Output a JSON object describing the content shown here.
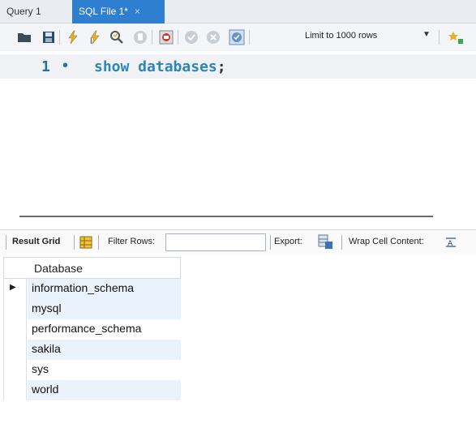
{
  "tabs": [
    {
      "label": "Query 1"
    },
    {
      "label": "SQL File 1*",
      "close": "×"
    }
  ],
  "toolbar": {
    "limit_label": "Limit to 1000 rows",
    "icons": [
      "folder-icon",
      "save-icon",
      "execute-icon",
      "execute-current-icon",
      "explain-icon",
      "stop-icon",
      "toggle-error-icon",
      "commit-icon",
      "rollback-icon",
      "autocommit-icon",
      "limit-dropdown",
      "beautify-icon"
    ]
  },
  "editor": {
    "line_number": "1",
    "code_keyword": "show databases",
    "code_semicolon": ";"
  },
  "result": {
    "result_grid_label": "Result Grid",
    "filter_rows_label": "Filter Rows:",
    "filter_value": "",
    "export_label": "Export:",
    "wrap_label": "Wrap Cell Content:",
    "column_header": "Database",
    "rows": [
      "information_schema",
      "mysql",
      "performance_schema",
      "sakila",
      "sys",
      "world"
    ]
  },
  "colors": {
    "active_tab": "#2f7fd0",
    "keyword": "#2c86b7",
    "line_number": "#1f6fb7",
    "stripe": "#eaf2fb"
  }
}
